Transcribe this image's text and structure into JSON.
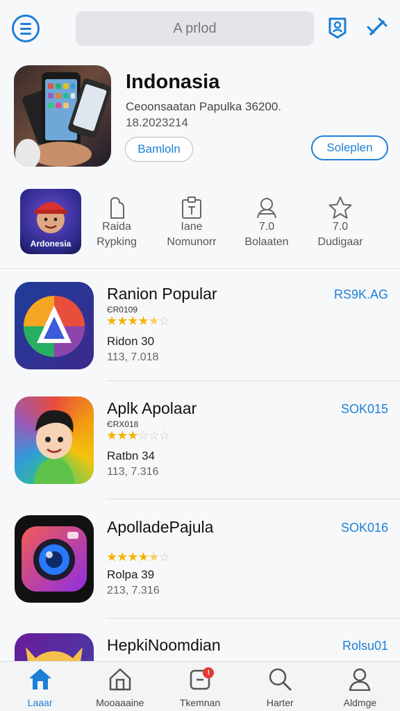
{
  "search": {
    "text": "A prlod"
  },
  "featured": {
    "title": "Indonasia",
    "subtitle": "Ceoonsaatan Papulka 36200.",
    "date": "18.2023214",
    "left_button": "Bamloln",
    "right_button": "Soleplen"
  },
  "stats_logo_label": "Ardonesia",
  "stats": [
    {
      "line1": "Raida",
      "line2": "Rypking",
      "icon": "bookmark-icon"
    },
    {
      "line1": "Iane",
      "line2": "Nomunorr",
      "icon": "clipboard-icon"
    },
    {
      "line1": "7.0",
      "line2": "Bolaaten",
      "icon": "user-icon"
    },
    {
      "line1": "7.0",
      "line2": "Dudigaar",
      "icon": "star-icon"
    }
  ],
  "apps": [
    {
      "title": "Ranion Popular",
      "code": "ЄR0109",
      "stars": 4.5,
      "rating": "Ridon 30",
      "count": "113, 7.018",
      "action": "RS9K.AG"
    },
    {
      "title": "Aplk Apolaar",
      "code": "ЄRX018",
      "stars": 3,
      "rating": "Ratbn 34",
      "count": "113, 7.316",
      "action": "SOK015"
    },
    {
      "title": "ApolladePajula",
      "code": "",
      "stars": 4.5,
      "rating": "Rolpa 39",
      "count": "213, 7.316",
      "action": "SOK016"
    },
    {
      "title": "HepkiNoomdian",
      "code": "",
      "stars": 0,
      "rating": "",
      "count": "",
      "action": "Rolsu01"
    }
  ],
  "nav": [
    {
      "label": "Laaar",
      "icon": "home-icon",
      "active": true
    },
    {
      "label": "Mooaaaine",
      "icon": "store-icon",
      "active": false
    },
    {
      "label": "Tkemnan",
      "icon": "notifications-icon",
      "active": false,
      "badge": "!"
    },
    {
      "label": "Harter",
      "icon": "search-icon",
      "active": false
    },
    {
      "label": "Aldmge",
      "icon": "profile-icon",
      "active": false
    }
  ],
  "colors": {
    "accent": "#1d7fd6",
    "star": "#f4b400",
    "badge": "#e53935"
  }
}
